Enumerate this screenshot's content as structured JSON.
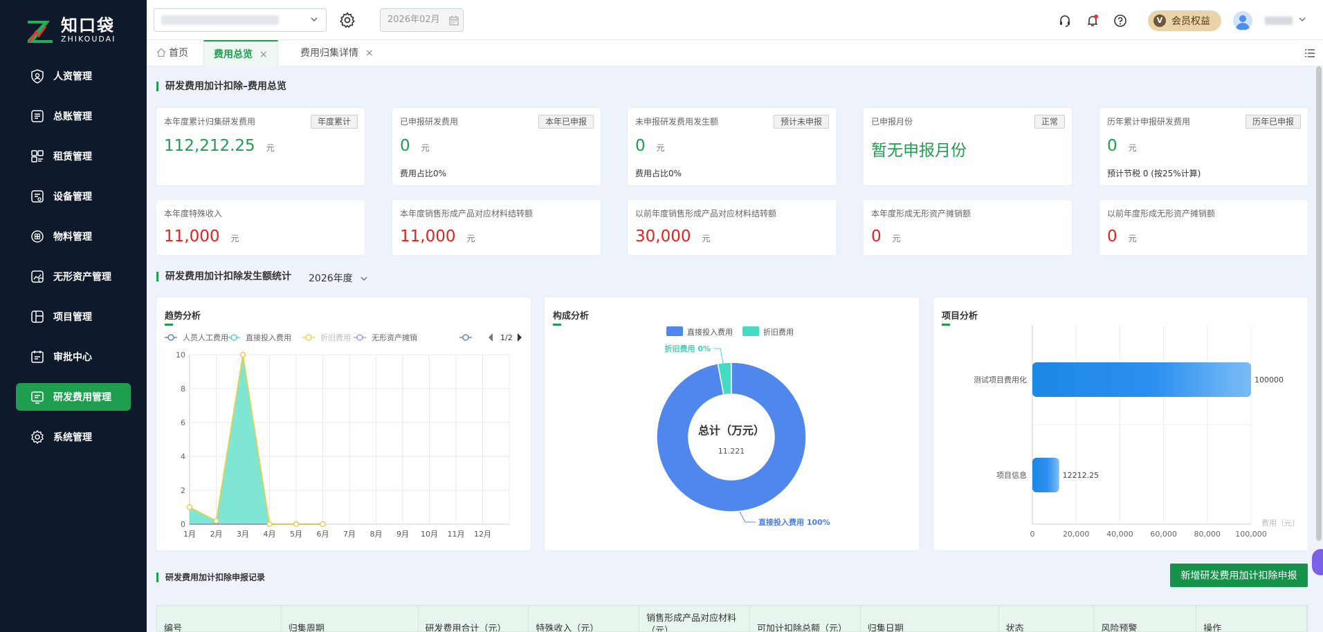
{
  "brand": {
    "name_cn": "知口袋",
    "name_en": "ZHIKOUDAI"
  },
  "sidebar": {
    "items": [
      {
        "label": "人资管理",
        "icon": "user-shield-icon",
        "active": false
      },
      {
        "label": "总账管理",
        "icon": "ledger-icon",
        "active": false
      },
      {
        "label": "租赁管理",
        "icon": "lease-icon",
        "active": false
      },
      {
        "label": "设备管理",
        "icon": "device-icon",
        "active": false
      },
      {
        "label": "物料管理",
        "icon": "material-icon",
        "active": false
      },
      {
        "label": "无形资产管理",
        "icon": "intangible-asset-icon",
        "active": false
      },
      {
        "label": "项目管理",
        "icon": "project-icon",
        "active": false
      },
      {
        "label": "审批中心",
        "icon": "approval-icon",
        "active": false
      },
      {
        "label": "研发费用管理",
        "icon": "rd-expense-icon",
        "active": true
      },
      {
        "label": "系统管理",
        "icon": "settings-icon",
        "active": false
      }
    ]
  },
  "header": {
    "date_value": "2026年02月",
    "vip_label": "会员权益",
    "vip_badge": "V"
  },
  "tabs": [
    {
      "label": "首页",
      "active": false,
      "closable": false
    },
    {
      "label": "费用总览",
      "active": true,
      "closable": true
    },
    {
      "label": "费用归集详情",
      "active": false,
      "closable": true
    }
  ],
  "tab_close_glyph": "×",
  "overview": {
    "title": "研发费用加计扣除–费用总览",
    "cards": [
      {
        "label": "本年度累计归集研发费用",
        "tag": "年度累计",
        "value": "112,212.25",
        "unit": "元",
        "sub": ""
      },
      {
        "label": "已申报研发费用",
        "tag": "本年已申报",
        "value": "0",
        "unit": "元",
        "sub": "费用占比0%"
      },
      {
        "label": "未申报研发费用发生额",
        "tag": "预计未申报",
        "value": "0",
        "unit": "元",
        "sub": "费用占比0%"
      },
      {
        "label": "已申报月份",
        "tag": "正常",
        "value": "暂无申报月份",
        "unit": "",
        "sub": ""
      },
      {
        "label": "历年累计申报研发费用",
        "tag": "历年已申报",
        "value": "0",
        "unit": "元",
        "sub": "预计节税 0 (按25%计算)"
      }
    ],
    "cards2": [
      {
        "label": "本年度特殊收入",
        "value": "11,000",
        "unit": "元"
      },
      {
        "label": "本年度销售形成产品对应材料结转额",
        "value": "11,000",
        "unit": "元"
      },
      {
        "label": "以前年度销售形成产品对应材料结转额",
        "value": "30,000",
        "unit": "元"
      },
      {
        "label": "本年度形成无形资产摊销额",
        "value": "0",
        "unit": "元"
      },
      {
        "label": "以前年度形成无形资产摊销额",
        "value": "0",
        "unit": "元"
      }
    ]
  },
  "stats": {
    "title": "研发费用加计扣除发生额统计",
    "year": "2026年度"
  },
  "chart_data": [
    {
      "type": "area",
      "title": "趋势分析",
      "legend_page": "1/2",
      "categories": [
        "1月",
        "2月",
        "3月",
        "4月",
        "5月",
        "6月",
        "7月",
        "8月",
        "9月",
        "10月",
        "11月",
        "12月"
      ],
      "ylim": [
        0,
        10
      ],
      "yticks": [
        "0",
        "2",
        "4",
        "6",
        "8",
        "10"
      ],
      "series": [
        {
          "name": "人员人工费用",
          "color": "#5470c6",
          "values": [
            0,
            0,
            0,
            0,
            0,
            0
          ]
        },
        {
          "name": "直接投入费用",
          "color": "#3fd0b6",
          "values": [
            1,
            0.2,
            10,
            0,
            0,
            0
          ]
        },
        {
          "name": "折旧费用",
          "color": "#f0d13e",
          "values": [
            1,
            0.2,
            10,
            0,
            0,
            0
          ]
        },
        {
          "name": "无形资产摊销",
          "color": "#9a8ce0",
          "values": [
            0,
            0,
            0,
            0,
            0,
            0
          ]
        }
      ]
    },
    {
      "type": "pie",
      "title": "构成分析",
      "center_label": "总计（万元）",
      "center_value": "11.221",
      "slices": [
        {
          "name": "直接投入费用",
          "value": 100,
          "color": "#5087ec",
          "label": "直接投入费用 100%"
        },
        {
          "name": "折旧费用",
          "value": 3,
          "color": "#43dbc4",
          "label": "折旧费用 0%"
        }
      ]
    },
    {
      "type": "bar",
      "title": "项目分析",
      "orientation": "horizontal",
      "categories": [
        "测试项目费用化",
        "项目信息"
      ],
      "values": [
        100000,
        12212.25
      ],
      "value_labels": [
        "100000",
        "12212.25"
      ],
      "xlim": [
        0,
        100000
      ],
      "xticks": [
        "0",
        "20,000",
        "40,000",
        "60,000",
        "80,000",
        "100,000"
      ],
      "xlabel": "费用（元）"
    }
  ],
  "records": {
    "title": "研发费用加计扣除申报记录",
    "add_button": "新增研发费用加计扣除申报",
    "columns": [
      "编号",
      "归集周期",
      "研发费用合计（元）",
      "特殊收入（元）",
      "销售形成产品对应材料（元）",
      "可加计扣除总额（元）",
      "归集日期",
      "状态",
      "风险预警",
      "操作"
    ]
  }
}
